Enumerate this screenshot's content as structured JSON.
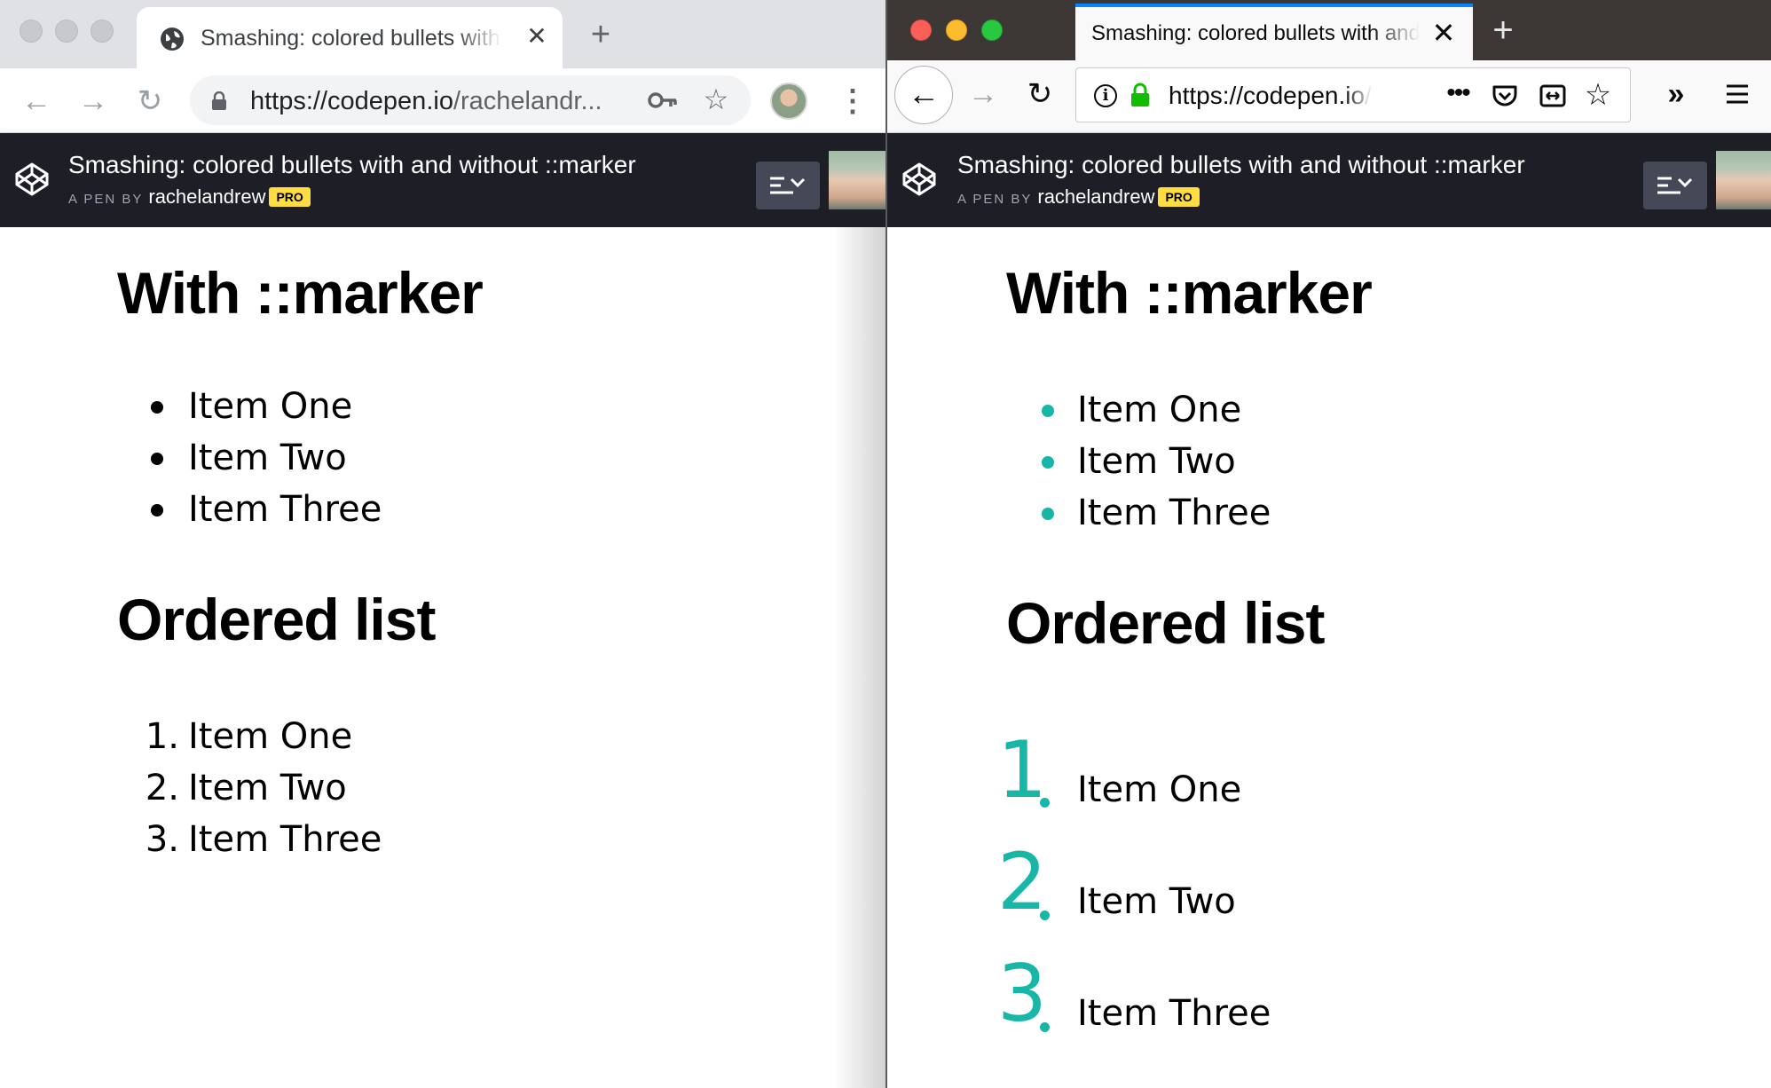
{
  "chrome": {
    "tab_title": "Smashing: colored bullets with and without ::marker",
    "close_glyph": "✕",
    "newtab_glyph": "+",
    "back_glyph": "←",
    "forward_glyph": "→",
    "reload_glyph": "↻",
    "url_host": "https://codepen.io",
    "url_path": "/rachelandr...",
    "star_glyph": "☆",
    "menu_glyph": "⋮"
  },
  "firefox": {
    "tab_title": "Smashing: colored bullets with and without ::marker",
    "close_glyph": "✕",
    "newtab_glyph": "+",
    "back_glyph": "←",
    "forward_glyph": "→",
    "reload_glyph": "↻",
    "info_glyph": "i",
    "url_host": "https://codepen.io",
    "url_path": "/rachelandrew/pen",
    "more_glyph": "•••",
    "star_glyph": "☆",
    "overflow_glyph": "»",
    "accent": "#0a84ff"
  },
  "codepen": {
    "pen_title": "Smashing: colored bullets with and without ::marker",
    "byline_prefix": "A PEN BY",
    "author": "rachelandrew",
    "pro_badge": "PRO"
  },
  "page": {
    "marker_heading": "With ::marker",
    "ordered_heading": "Ordered list",
    "unordered_items": [
      "Item One",
      "Item Two",
      "Item Three"
    ],
    "ordered_items": [
      "Item One",
      "Item Two",
      "Item Three"
    ],
    "ordered_numbers_plain": [
      "1.",
      "2.",
      "3."
    ],
    "ordered_numbers_big": [
      "1",
      "2",
      "3"
    ],
    "marker_color": "#17b6a7",
    "default_color": "#000000"
  }
}
